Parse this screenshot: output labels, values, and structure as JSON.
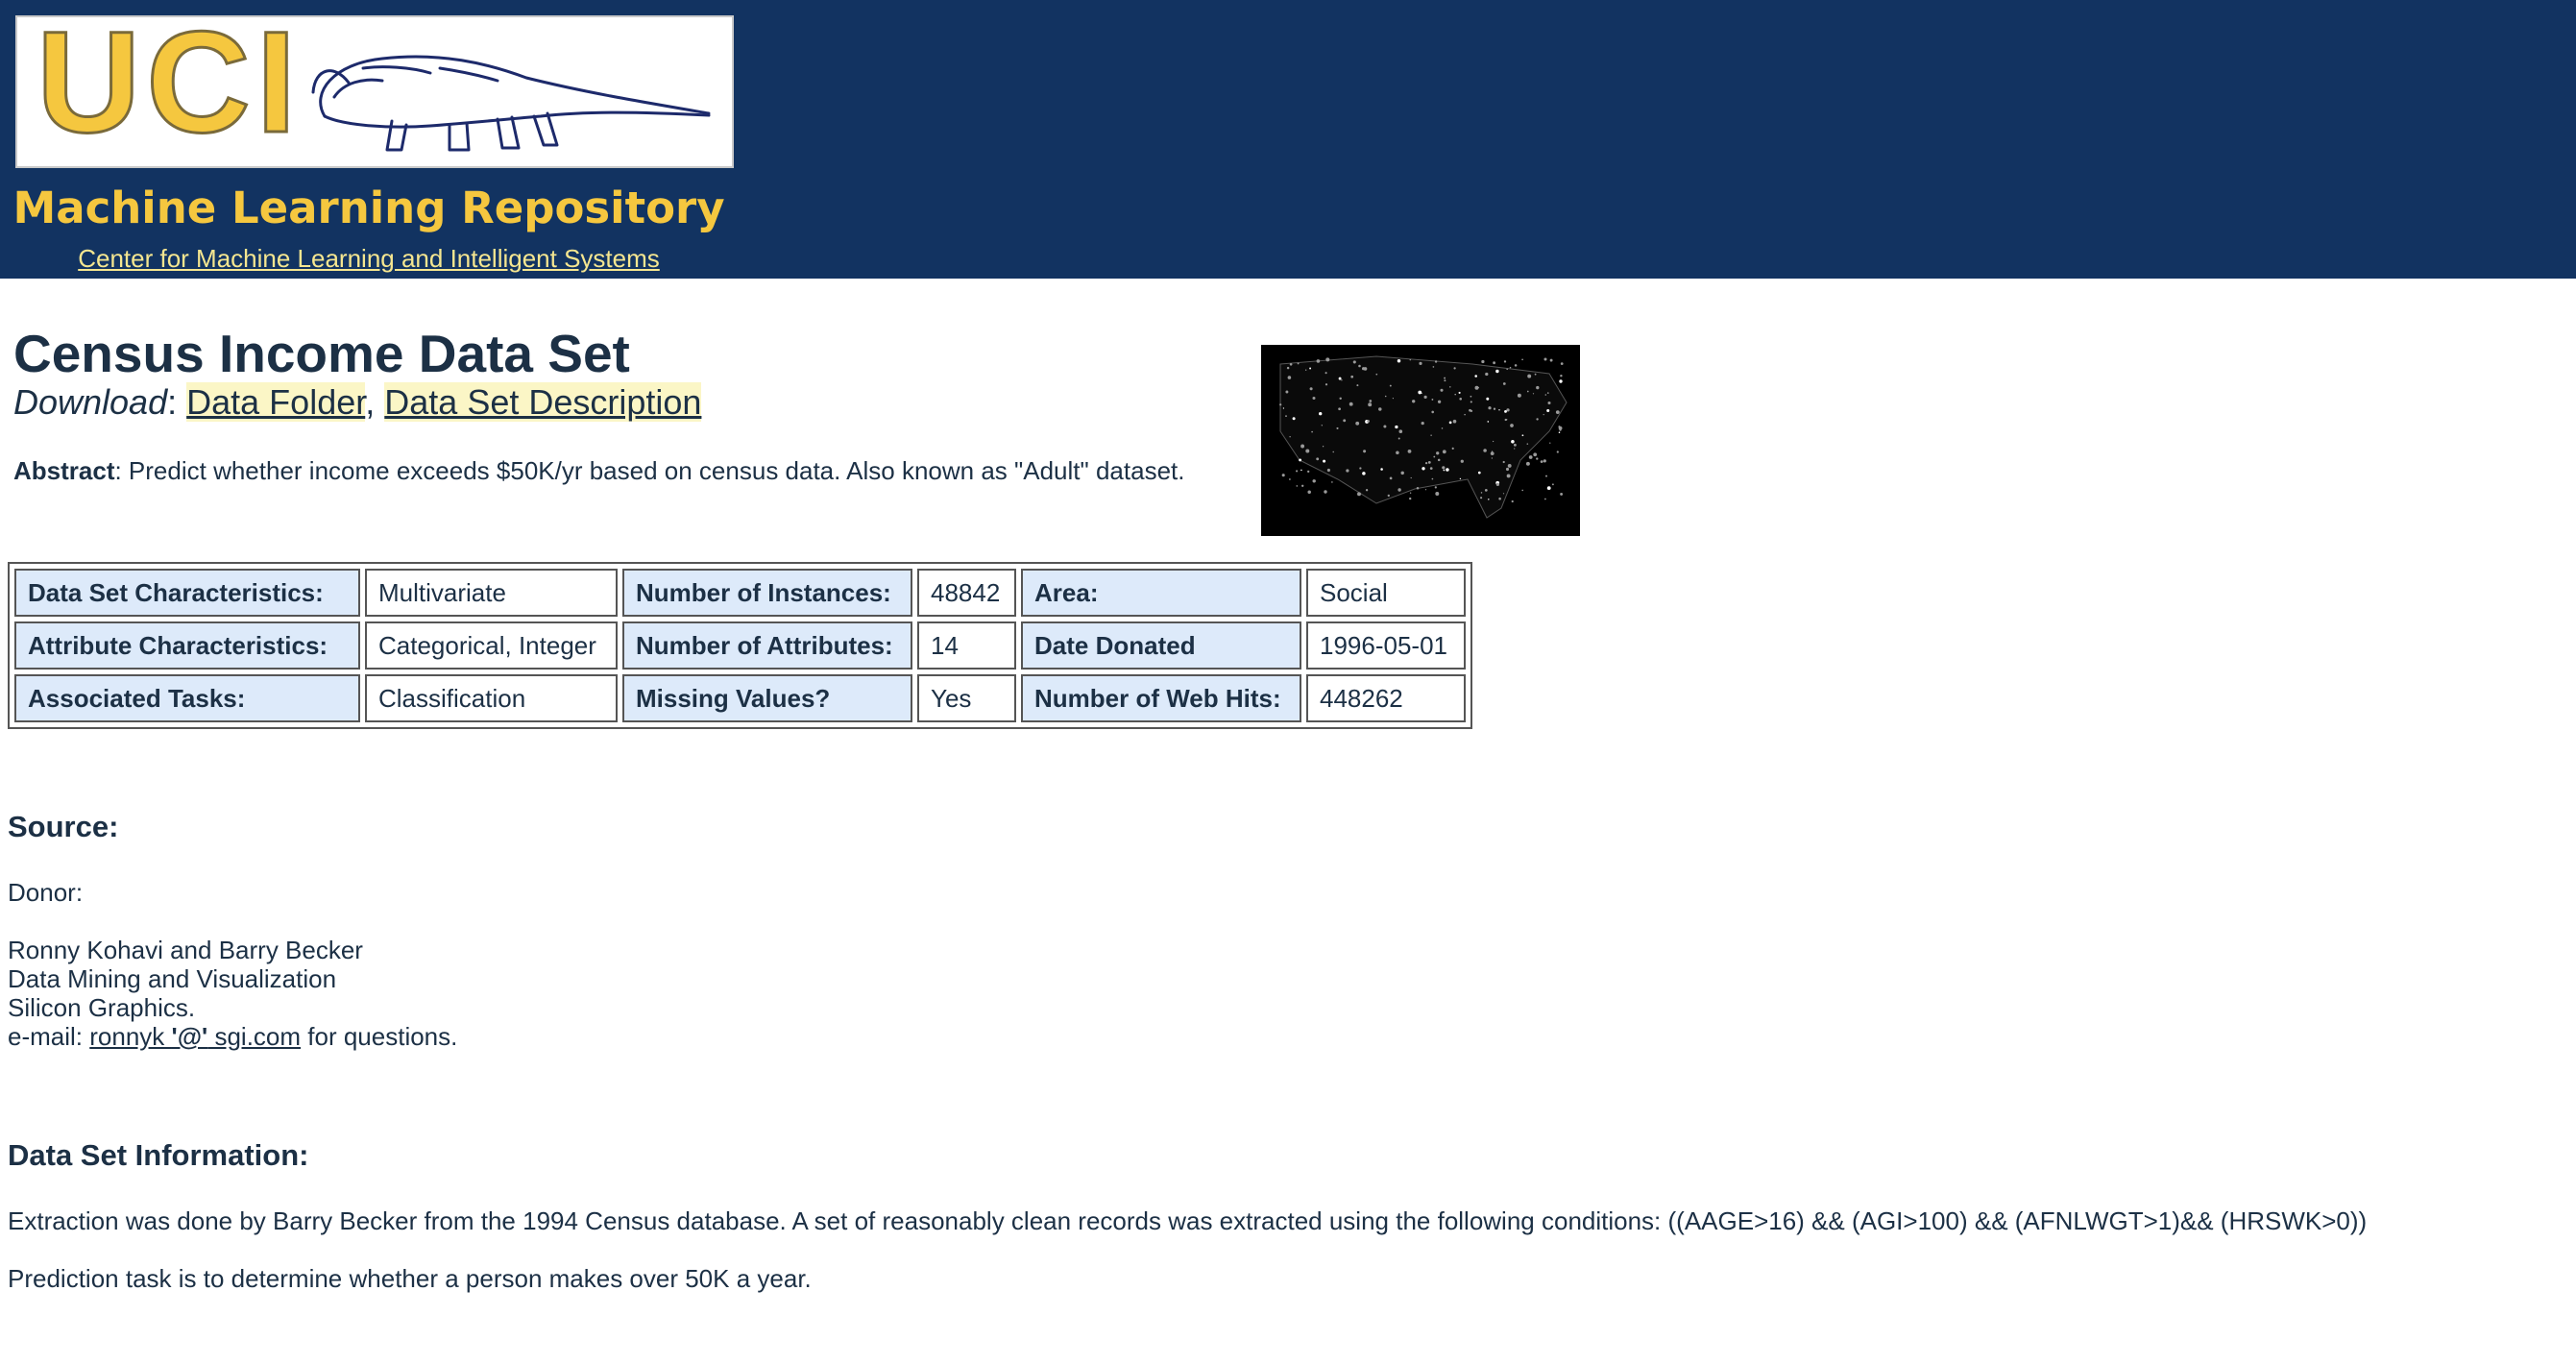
{
  "header": {
    "logo_text": "UCI",
    "site_title": "Machine Learning Repository",
    "site_subtitle": "Center for Machine Learning and Intelligent Systems"
  },
  "page": {
    "title": "Census Income Data Set",
    "download_label": "Download",
    "download_links": [
      "Data Folder",
      "Data Set Description"
    ],
    "abstract_label": "Abstract",
    "abstract_text": ": Predict whether income exceeds $50K/yr based on census data. Also known as \"Adult\" dataset."
  },
  "characteristics": {
    "rows": [
      [
        {
          "key": "Data Set Characteristics:",
          "value": "Multivariate"
        },
        {
          "key": "Number of Instances:",
          "value": "48842"
        },
        {
          "key": "Area:",
          "value": "Social"
        }
      ],
      [
        {
          "key": "Attribute Characteristics:",
          "value": "Categorical, Integer"
        },
        {
          "key": "Number of Attributes:",
          "value": "14"
        },
        {
          "key": "Date Donated",
          "value": "1996-05-01"
        }
      ],
      [
        {
          "key": "Associated Tasks:",
          "value": "Classification"
        },
        {
          "key": "Missing Values?",
          "value": "Yes"
        },
        {
          "key": "Number of Web Hits:",
          "value": "448262"
        }
      ]
    ]
  },
  "source": {
    "heading": "Source:",
    "donor_label": "Donor:",
    "lines": [
      "Ronny Kohavi and Barry Becker",
      "Data Mining and Visualization",
      "Silicon Graphics."
    ],
    "email_prefix": "e-mail: ",
    "email_user": "ronnyk ",
    "email_at": "'@'",
    "email_domain": " sgi.com",
    "email_suffix": " for questions."
  },
  "info": {
    "heading": "Data Set Information:",
    "para1": "Extraction was done by Barry Becker from the 1994 Census database. A set of reasonably clean records was extracted using the following conditions: ((AAGE>16) && (AGI>100) && (AFNLWGT>1)&& (HRSWK>0))",
    "para2": "Prediction task is to determine whether a person makes over 50K a year."
  },
  "colors": {
    "header_bg": "#123361",
    "logo_yellow": "#f5c73f",
    "text": "#1c3045",
    "key_cell_bg": "#ddeafa",
    "link_highlight": "#fbf6c6"
  },
  "icons": [
    "anteater-logo",
    "usa-night-lights-map"
  ]
}
